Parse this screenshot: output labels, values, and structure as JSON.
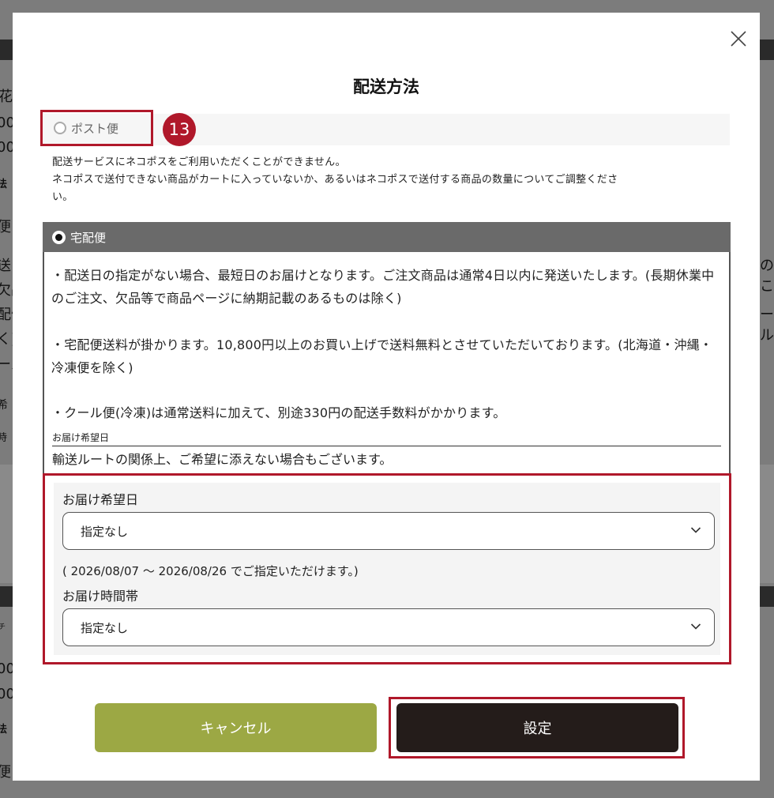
{
  "background": {
    "fragments": [
      "花",
      "00",
      "00",
      "法",
      "便",
      "送日",
      "欠品",
      "配便",
      "く)",
      "ール",
      "希",
      "時",
      "チ",
      "00",
      "00",
      "法",
      "便",
      "のこ",
      "ール"
    ]
  },
  "modal": {
    "title": "配送方法",
    "close_icon": "close-icon",
    "post_option": {
      "label": "ポスト便",
      "selected": false,
      "step_badge": "13",
      "note_lines": [
        "配送サービスにネコポスをご利用いただくことができません。",
        "ネコポスで送付できない商品がカートに入っていないか、あるいはネコポスで送付する商品の数量についてご調整くださ",
        "い。"
      ]
    },
    "takuhai_option": {
      "label": "宅配便",
      "selected": true,
      "paragraphs": [
        "・配送日の指定がない場合、最短日のお届けとなります。ご注文商品は通常4日以内に発送いたします。(長期休業中のご注文、欠品等で商品ページに納期記載のあるものは除く)",
        "・宅配便送料が掛かります。10,800円以上のお買い上げで送料無料とさせていただいております。(北海道・沖縄・冷凍便を除く)",
        "・クール便(冷凍)は通常送料に加えて、別途330円の配送手数料がかかります。"
      ],
      "small_heading": "お届け希望日",
      "route_note": "輸送ルートの関係上、ご希望に添えない場合もございます。"
    },
    "delivery": {
      "date_label": "お届け希望日",
      "date_value": "指定なし",
      "date_range_note": "( 2026/08/07 〜 2026/08/26 でご指定いただけます。)",
      "time_label": "お届け時間帯",
      "time_value": "指定なし"
    },
    "buttons": {
      "cancel": "キャンセル",
      "set": "設定"
    },
    "colors": {
      "highlight": "#b0182a",
      "cancel_bg": "#9ca844",
      "set_bg": "#241c1a",
      "selected_header": "#6a6a6a"
    }
  }
}
